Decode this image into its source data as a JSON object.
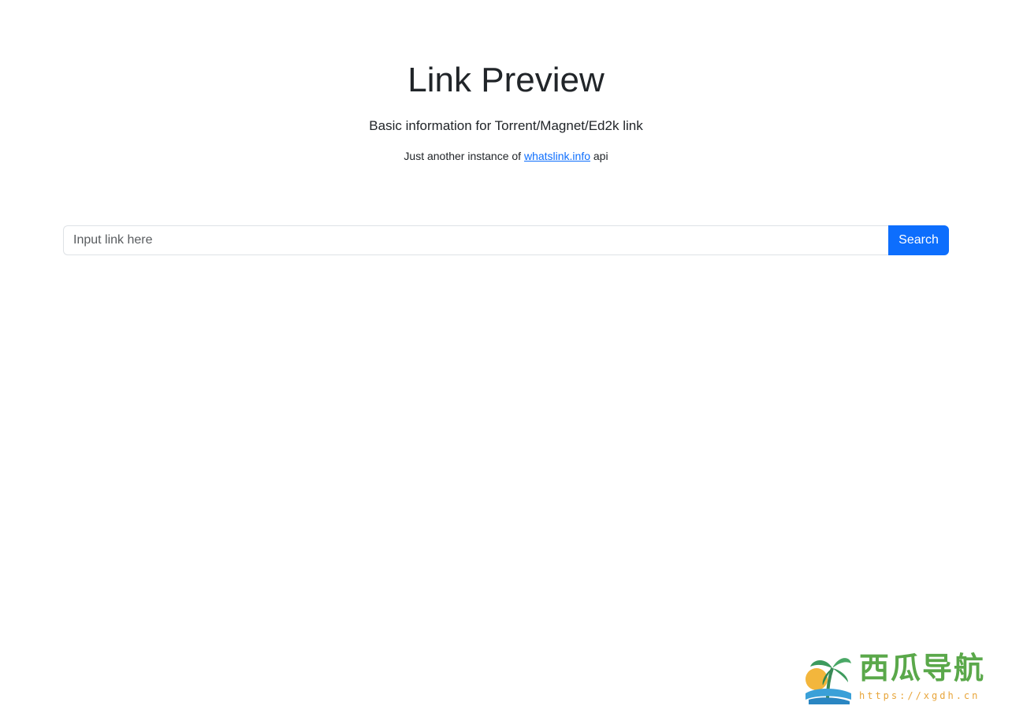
{
  "header": {
    "title": "Link Preview",
    "subtitle": "Basic information for Torrent/Magnet/Ed2k link",
    "note_prefix": "Just another instance of ",
    "note_link": "whatslink.info",
    "note_suffix": " api"
  },
  "search": {
    "placeholder": "Input link here",
    "value": "",
    "button_label": "Search"
  },
  "watermark": {
    "text": "西瓜导航",
    "url": "https://xgdh.cn"
  },
  "colors": {
    "primary": "#0d6efd",
    "text": "#212529",
    "border": "#dee2e6",
    "watermark_green": "#5aa84a",
    "watermark_orange": "#e8a53a"
  }
}
